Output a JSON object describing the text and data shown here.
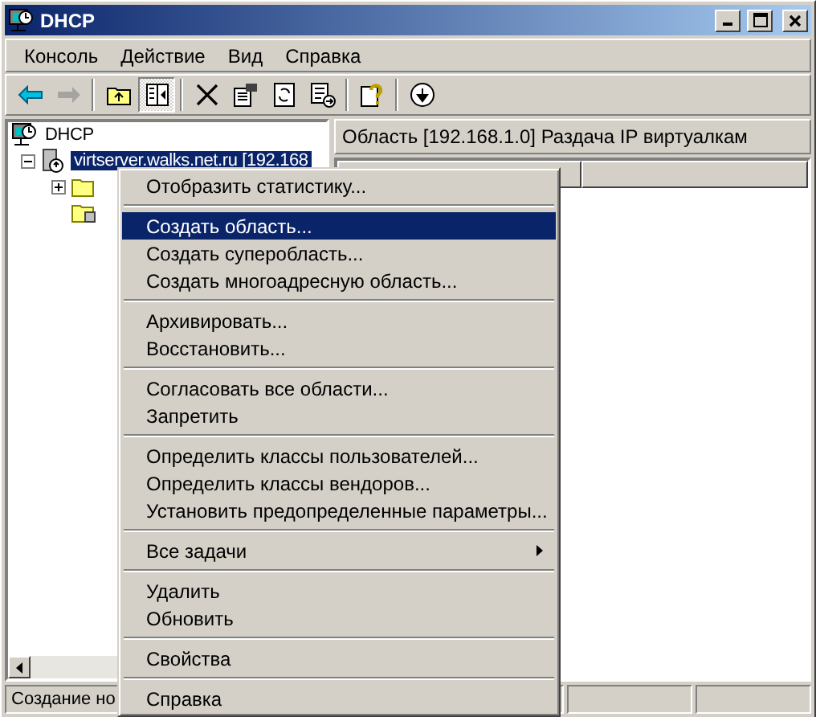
{
  "window": {
    "title": "DHCP",
    "buttons": [
      {
        "kind": "minimize"
      },
      {
        "kind": "maximize"
      },
      {
        "kind": "close"
      }
    ]
  },
  "menu_bar": [
    {
      "label": "Консоль"
    },
    {
      "label": "Действие"
    },
    {
      "label": "Вид"
    },
    {
      "label": "Справка"
    }
  ],
  "toolbar": [
    {
      "kind": "back",
      "disabled": false,
      "pressed": false
    },
    {
      "kind": "forward",
      "disabled": true,
      "pressed": false
    },
    {
      "kind": "separator"
    },
    {
      "kind": "up",
      "disabled": false,
      "pressed": false
    },
    {
      "kind": "tree",
      "disabled": false,
      "pressed": true
    },
    {
      "kind": "separator"
    },
    {
      "kind": "delete",
      "disabled": false,
      "pressed": false
    },
    {
      "kind": "properties",
      "disabled": false,
      "pressed": false
    },
    {
      "kind": "refresh",
      "disabled": false,
      "pressed": false
    },
    {
      "kind": "export",
      "disabled": false,
      "pressed": false
    },
    {
      "kind": "separator"
    },
    {
      "kind": "help",
      "disabled": false,
      "pressed": false
    },
    {
      "kind": "separator"
    },
    {
      "kind": "action",
      "disabled": false,
      "pressed": false
    }
  ],
  "tree": [
    {
      "label": "DHCP",
      "kind": "dhcp",
      "selected": false,
      "children": [
        {
          "label": "virtserver.walks.net.ru [192.168",
          "kind": "server",
          "selected": true,
          "expanded": true,
          "children": [
            {
              "kind": "folder",
              "expanded": false
            },
            {
              "kind": "options"
            }
          ]
        }
      ]
    }
  ],
  "scope_header": "Область [192.168.1.0] Раздача IP виртуалкам",
  "context_menu": [
    {
      "kind": "item",
      "label": "Отобразить статистику...",
      "selected": false
    },
    {
      "kind": "separator"
    },
    {
      "kind": "item",
      "label": "Создать область...",
      "selected": true
    },
    {
      "kind": "item",
      "label": "Создать суперобласть...",
      "selected": false
    },
    {
      "kind": "item",
      "label": "Создать многоадресную область...",
      "selected": false
    },
    {
      "kind": "separator"
    },
    {
      "kind": "item",
      "label": "Архивировать...",
      "selected": false
    },
    {
      "kind": "item",
      "label": "Восстановить...",
      "selected": false
    },
    {
      "kind": "separator"
    },
    {
      "kind": "item",
      "label": "Согласовать все области...",
      "selected": false
    },
    {
      "kind": "item",
      "label": "Запретить",
      "selected": false
    },
    {
      "kind": "separator"
    },
    {
      "kind": "item",
      "label": "Определить классы пользователей...",
      "selected": false
    },
    {
      "kind": "item",
      "label": "Определить классы вендоров...",
      "selected": false
    },
    {
      "kind": "item",
      "label": "Установить предопределенные параметры...",
      "selected": false
    },
    {
      "kind": "separator"
    },
    {
      "kind": "submenu",
      "label": "Все задачи",
      "selected": false
    },
    {
      "kind": "separator"
    },
    {
      "kind": "item",
      "label": "Удалить",
      "selected": false
    },
    {
      "kind": "item",
      "label": "Обновить",
      "selected": false
    },
    {
      "kind": "separator"
    },
    {
      "kind": "item",
      "label": "Свойства",
      "selected": false
    },
    {
      "kind": "separator"
    },
    {
      "kind": "item",
      "label": "Справка",
      "selected": false
    }
  ],
  "status_bar": {
    "text": "Создание но"
  }
}
